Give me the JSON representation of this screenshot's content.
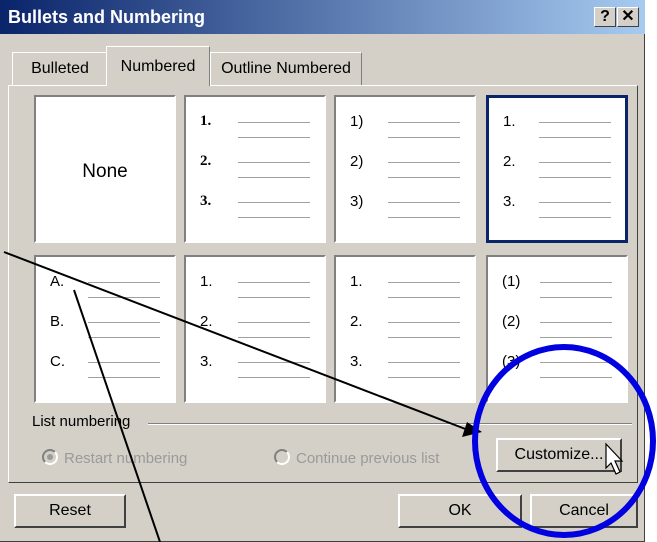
{
  "window": {
    "title": "Bullets and Numbering",
    "help_glyph": "?",
    "close_glyph": "✕"
  },
  "tabs": [
    {
      "label": "Bulleted"
    },
    {
      "label": "Numbered"
    },
    {
      "label": "Outline Numbered"
    }
  ],
  "active_tab": "Numbered",
  "styles": [
    {
      "none_label": "None"
    },
    {
      "markers": [
        "1.",
        "2.",
        "3."
      ]
    },
    {
      "markers": [
        "1)",
        "2)",
        "3)"
      ]
    },
    {
      "markers": [
        "1.",
        "2.",
        "3."
      ]
    },
    {
      "markers": [
        "A.",
        "B.",
        "C."
      ]
    },
    {
      "markers": [
        "1.",
        "2.",
        "3."
      ]
    },
    {
      "markers": [
        "1.",
        "2.",
        "3."
      ]
    },
    {
      "markers": [
        "(1)",
        "(2)",
        "(3)"
      ]
    }
  ],
  "selected_style": 3,
  "list_numbering": {
    "label": "List numbering",
    "restart_label": "Restart numbering",
    "continue_label": "Continue previous list",
    "restart_selected": true
  },
  "buttons": {
    "customize": "Customize...",
    "reset": "Reset",
    "ok": "OK",
    "cancel": "Cancel"
  },
  "annotations": {
    "circle_color": "#0000e0",
    "arrow_color": "#000000"
  }
}
